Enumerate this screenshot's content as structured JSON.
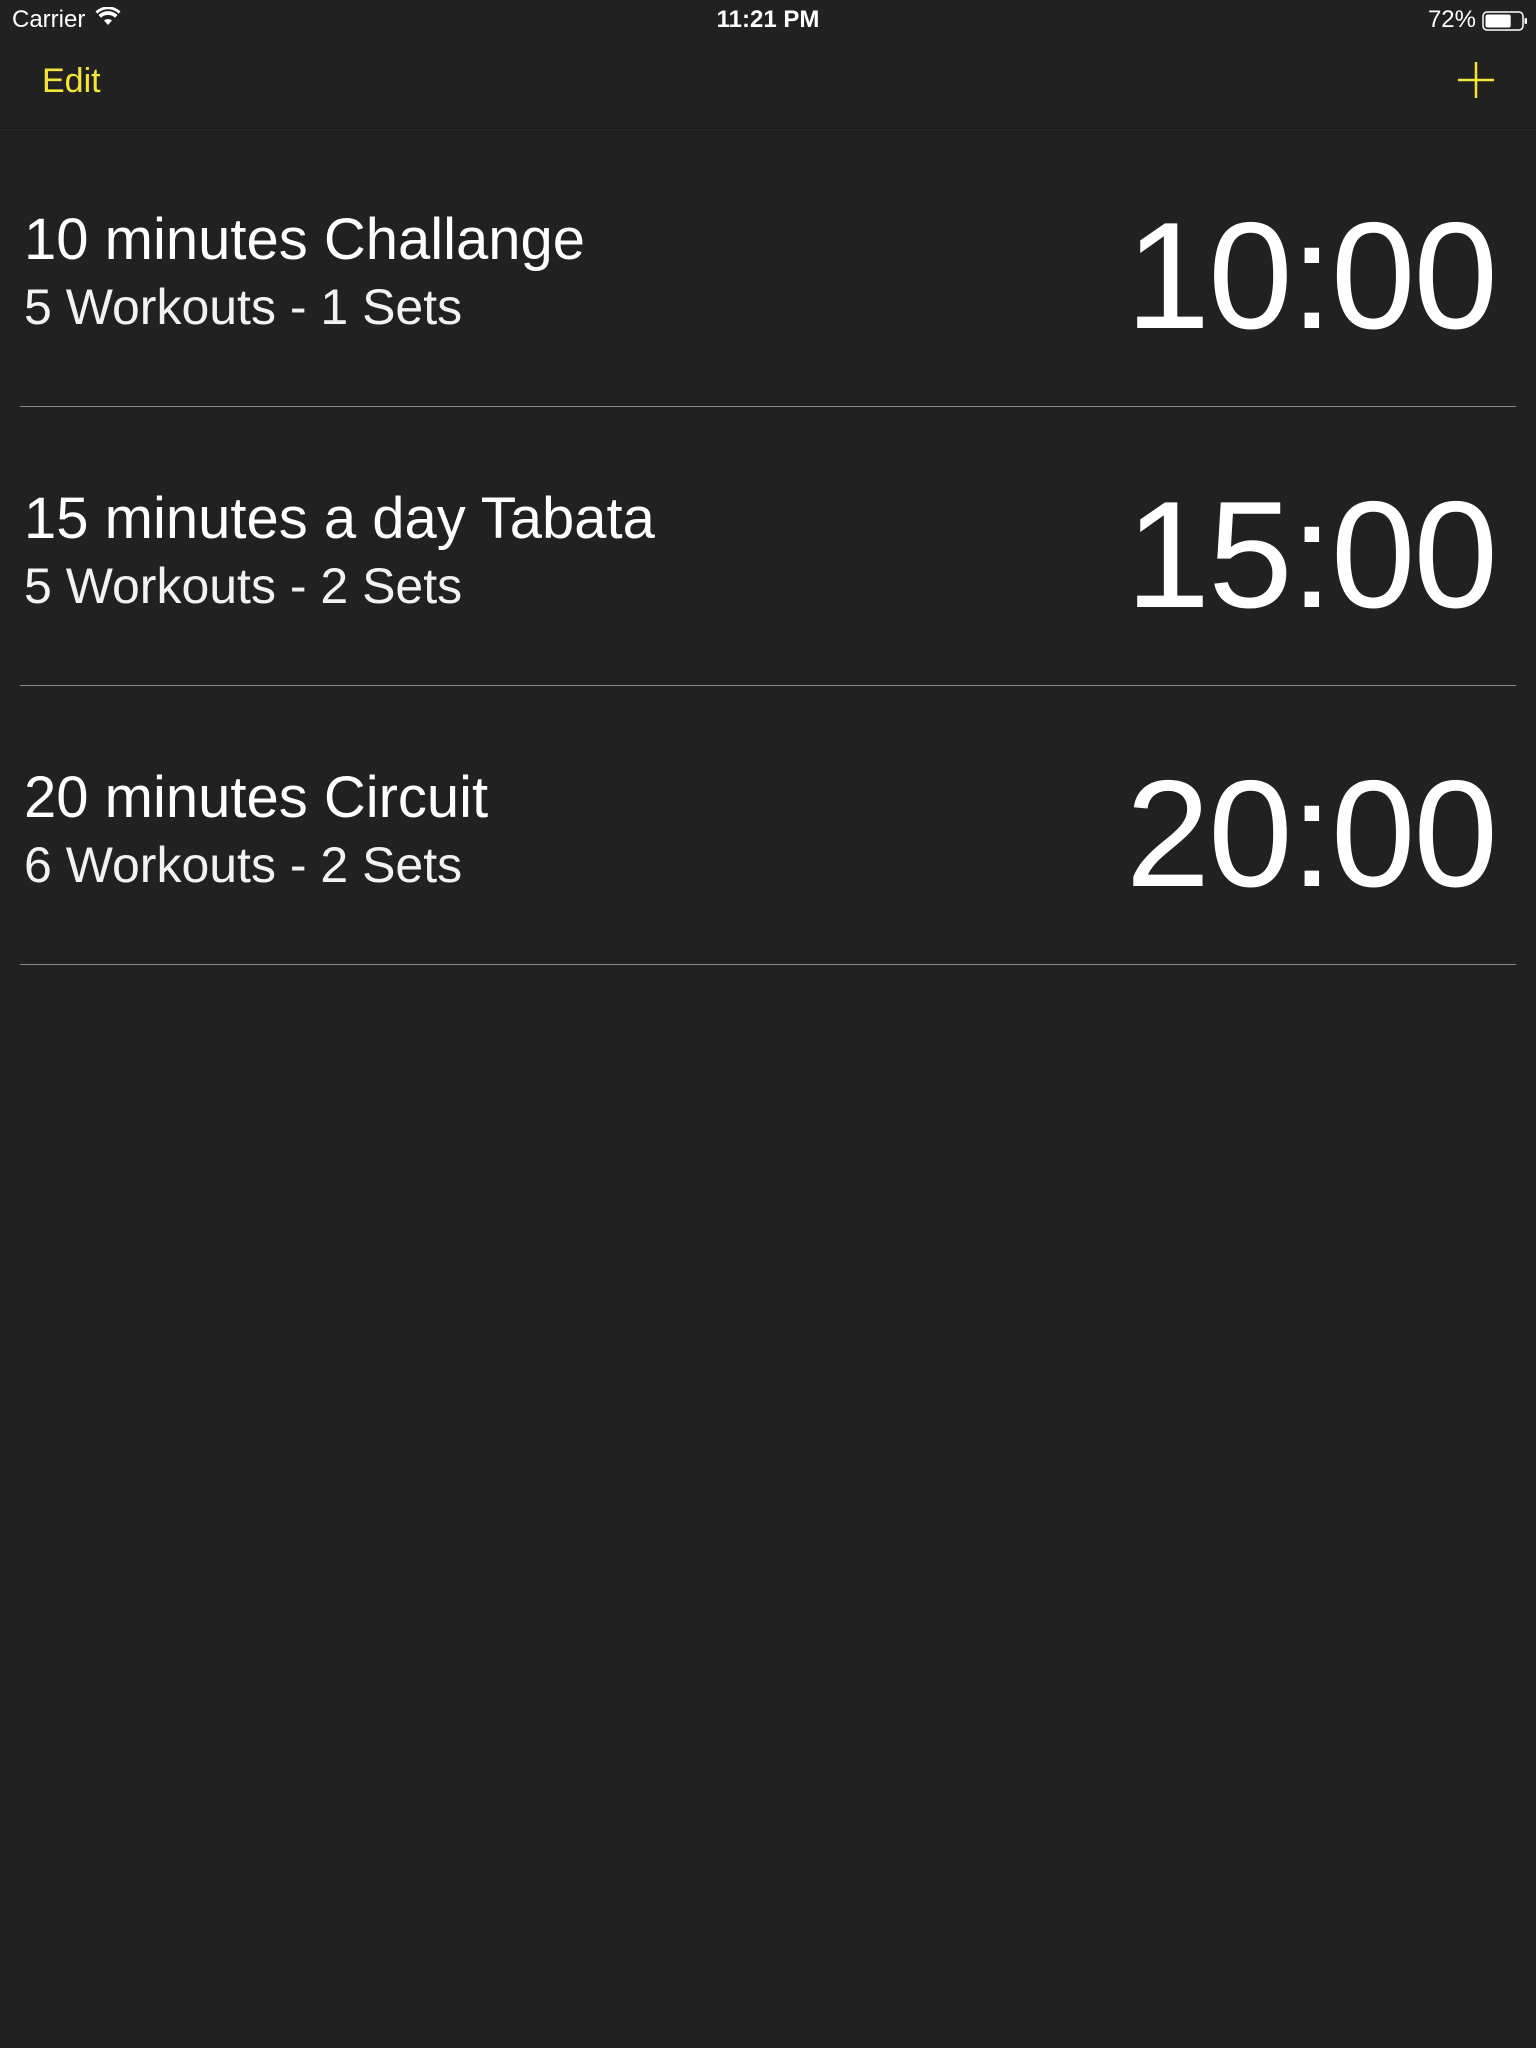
{
  "status_bar": {
    "carrier": "Carrier",
    "time": "11:21 PM",
    "battery": "72%",
    "battery_level": 0.72
  },
  "nav": {
    "edit_label": "Edit",
    "add_icon": "plus-icon"
  },
  "colors": {
    "background": "#212121",
    "accent": "#f5e53a",
    "text": "#ffffff",
    "divider": "#8c8c8c"
  },
  "workouts": [
    {
      "title": "10 minutes Challange",
      "subtitle": "5 Workouts - 1 Sets",
      "time": "10:00"
    },
    {
      "title": "15 minutes a day Tabata",
      "subtitle": "5 Workouts - 2 Sets",
      "time": "15:00"
    },
    {
      "title": "20 minutes Circuit",
      "subtitle": "6 Workouts - 2 Sets",
      "time": "20:00"
    }
  ]
}
